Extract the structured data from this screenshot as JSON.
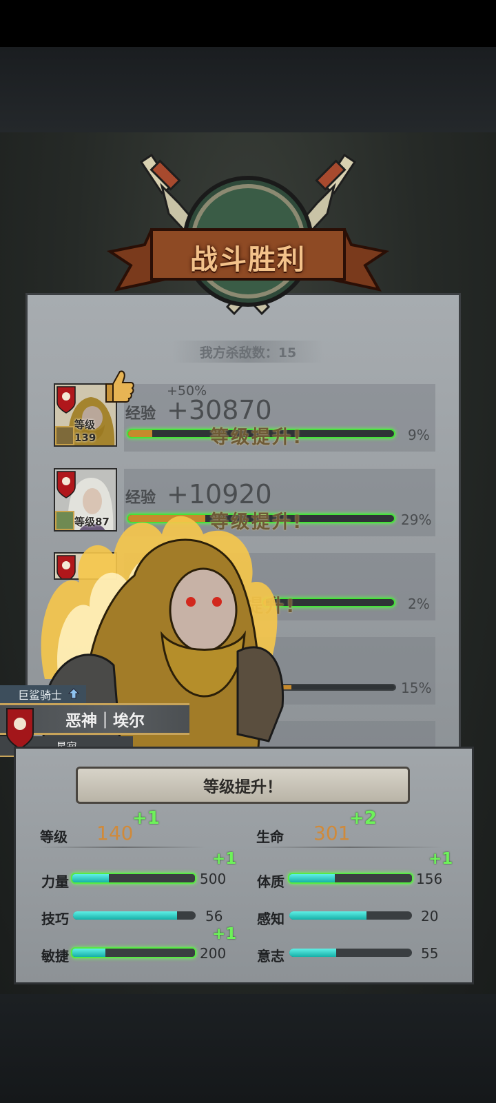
{
  "banner": {
    "title": "战斗胜利"
  },
  "kills": {
    "text": "我方杀敌数：15"
  },
  "results": [
    {
      "exp_label": "经验",
      "exp_value": "+30870",
      "bonus": "+50%",
      "level_text": "等级139",
      "level_up": "等级提升!",
      "percent": "9%",
      "progress": 0.09
    },
    {
      "exp_label": "经验",
      "exp_value": "+10920",
      "level_text": "等级87",
      "level_up": "等级提升!",
      "percent": "29%",
      "progress": 0.29
    },
    {
      "level_up_partial": "提升!",
      "percent": "2%",
      "progress": 0.02
    },
    {
      "percent": "15%",
      "progress": 0.15
    }
  ],
  "hero": {
    "class": "巨鲨骑士",
    "name": "恶神｜埃尔",
    "title": "星寂"
  },
  "levelup_panel": {
    "title": "等级提升！",
    "level": {
      "label": "等级",
      "value": "140",
      "plus": "+1"
    },
    "life": {
      "label": "生命",
      "value": "301",
      "plus": "+2"
    },
    "stats": [
      {
        "label": "力量",
        "value": "500",
        "plus": "+1",
        "fill": 0.3,
        "up": true
      },
      {
        "label": "体质",
        "value": "156",
        "plus": "+1",
        "fill": 0.37,
        "up": true
      },
      {
        "label": "技巧",
        "value": "56",
        "fill": 0.85,
        "up": false
      },
      {
        "label": "感知",
        "value": "20",
        "fill": 0.63,
        "up": false
      },
      {
        "label": "敏捷",
        "value": "200",
        "plus": "+1",
        "fill": 0.27,
        "up": true
      },
      {
        "label": "意志",
        "value": "55",
        "fill": 0.38,
        "up": false
      }
    ]
  }
}
